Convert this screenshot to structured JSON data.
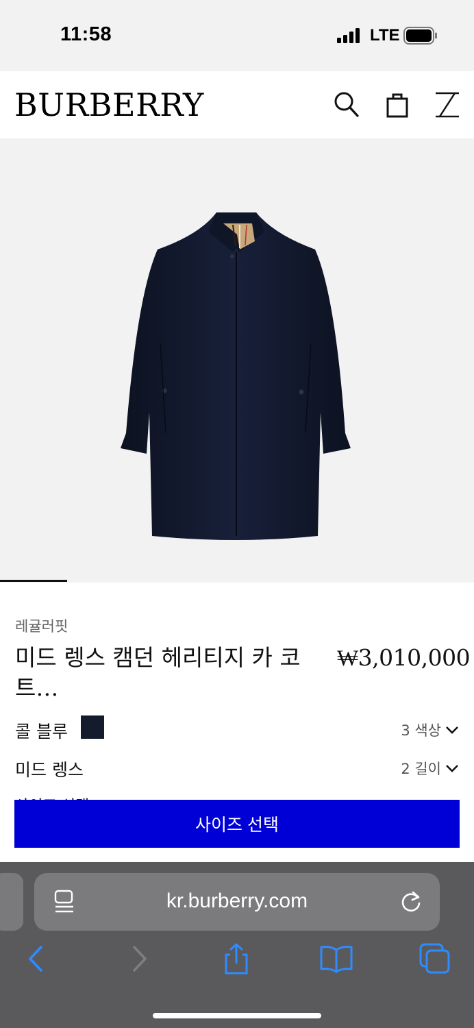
{
  "status": {
    "time": "11:58",
    "network": "LTE"
  },
  "header": {
    "logo": "BURBERRY"
  },
  "product": {
    "fit": "레귤러핏",
    "title": "미드 렝스 캠던 헤리티지 카 코트…",
    "price": "₩3,010,000",
    "color_label": "콜 블루",
    "color_swatch": "#141b2d",
    "color_count": "3 색상",
    "length_label": "미드 렝스",
    "length_count": "2 길이",
    "size_prompt_partial": "사이즈 선택:",
    "cta_label": "사이즈 선택"
  },
  "browser": {
    "url": "kr.burberry.com"
  },
  "colors": {
    "cta": "#0000d6",
    "coat": "#141b2d"
  }
}
